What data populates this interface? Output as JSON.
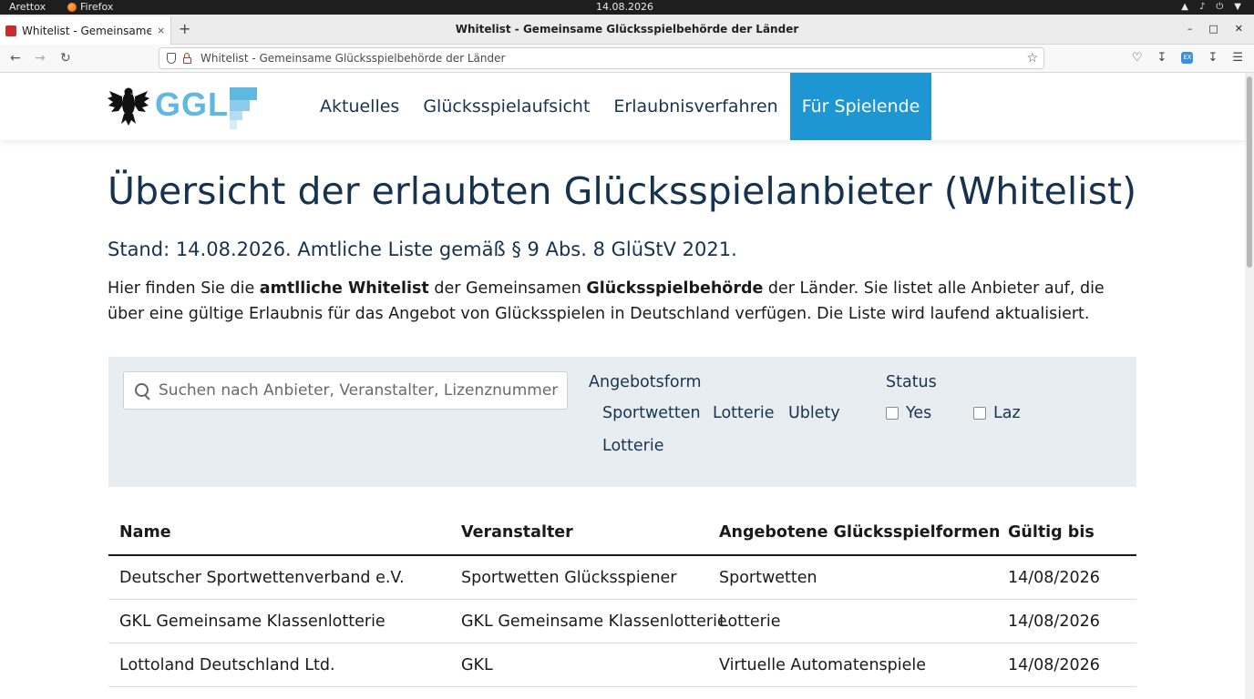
{
  "os": {
    "app_name": "Arettox",
    "browser_name": "Firefox",
    "date": "14.08.2026"
  },
  "browser": {
    "tab_title": "Whitelist - Gemeinsame Glücksspielbehörde der Länder",
    "window_title": "Whitelist - Gemeinsame Glücksspielbehörde der Länder",
    "url": "Whitelist - Gemeinsame Glücksspielbehörde der Länder",
    "tab_close": "×",
    "new_tab": "+",
    "extension_label": "EX"
  },
  "site": {
    "logo_text": "GGL",
    "nav": [
      {
        "label": "Aktuelles"
      },
      {
        "label": "Glücksspielaufsicht"
      },
      {
        "label": "Erlaubnisverfahren"
      },
      {
        "label": "Für Spielende"
      }
    ],
    "accent_color": "#1e96d3"
  },
  "content": {
    "title": "Übersicht der erlaubten Glücksspielanbieter (Whitelist)",
    "subtitle": "Stand: 14.08.2026. Amtliche Liste gemäß § 9 Abs. 8 GlüStV 2021.",
    "intro": {
      "p1": "Hier finden Sie die ",
      "b1": "amtlliche Whitelist",
      "p2": " der Gemeinsamen ",
      "b2": "Glücksspielbehörde",
      "p3": " der Länder. Sie listet alle Anbieter auf, die über eine gültige Erlaubnis für das Angebot von Glücksspielen in Deutschland verfügen. Die Liste wird laufend aktualisiert."
    }
  },
  "filters": {
    "search_placeholder": "Suchen nach Anbieter, Veranstalter, Lizenznummer",
    "offer_label": "Angebotsform",
    "offer_options": [
      "Sportwetten",
      "Lotterie",
      "Ublety",
      "Lotterie"
    ],
    "status_label": "Status",
    "status_options": [
      "Yes",
      "Laz"
    ]
  },
  "table": {
    "headers": [
      "Name",
      "Veranstalter",
      "Angebotene Glücksspielformen",
      "Gültig bis"
    ],
    "rows": [
      [
        "Deutscher Sportwettenverband e.V.",
        "Sportwetten Glücksspiener",
        "Sportwetten",
        "14/08/2026"
      ],
      [
        "GKL Gemeinsame Klassenlotterie",
        "GKL Gemeinsame Klassenlotterie",
        "Lotterie",
        "14/08/2026"
      ],
      [
        "Lottoland Deutschland Ltd.",
        "GKL",
        "Virtuelle Automatenspiele",
        "14/08/2026"
      ]
    ]
  }
}
